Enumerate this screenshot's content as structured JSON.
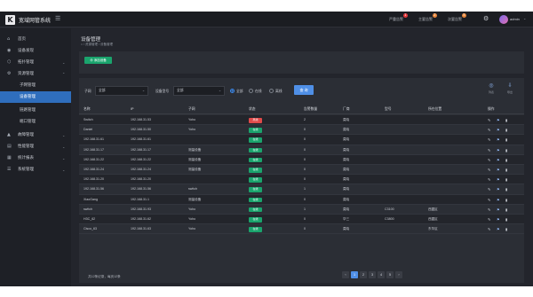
{
  "app": {
    "title": "宽域网管系统",
    "logo_letter": "K"
  },
  "topbar": {
    "alerts": [
      {
        "label": "严重告警",
        "count": "1",
        "color": "#e4393c"
      },
      {
        "label": "主要告警",
        "count": "2",
        "color": "#e8873b"
      },
      {
        "label": "次要告警",
        "count": "5",
        "color": "#e8873b"
      }
    ],
    "username": "admin"
  },
  "sidebar": {
    "items": [
      {
        "label": "首页",
        "icon": "home-icon",
        "glyph": "⌂"
      },
      {
        "label": "设备发现",
        "icon": "discover-icon",
        "glyph": "◉"
      },
      {
        "label": "拓扑管理",
        "icon": "topology-icon",
        "glyph": "⬡",
        "chevron": "⌄"
      },
      {
        "label": "资源管理",
        "icon": "resource-icon",
        "glyph": "⚙",
        "chevron": "⌃"
      },
      {
        "label": "子网管理",
        "sub": true
      },
      {
        "label": "设备管理",
        "sub": true,
        "active": true
      },
      {
        "label": "链路管理",
        "sub": true
      },
      {
        "label": "端口管理",
        "sub": true
      },
      {
        "label": "故障管理",
        "icon": "warning-icon",
        "glyph": "▲",
        "chevron": "⌄"
      },
      {
        "label": "性能管理",
        "icon": "performance-icon",
        "glyph": "▤",
        "chevron": "⌄"
      },
      {
        "label": "统计报表",
        "icon": "report-icon",
        "glyph": "▦",
        "chevron": "⌄"
      },
      {
        "label": "系统管理",
        "icon": "system-icon",
        "glyph": "☰",
        "chevron": "⌄"
      }
    ]
  },
  "page": {
    "title": "设备管理",
    "breadcrumb": "⌂ / 资源管理 / 设备管理",
    "add_button": "⊕ 添加设备"
  },
  "filters": {
    "subnet_label": "子网",
    "subnet_value": "全部",
    "model_label": "设备型号",
    "model_value": "全部",
    "radios": [
      {
        "label": "全部",
        "checked": true
      },
      {
        "label": "在线",
        "checked": false
      },
      {
        "label": "离线",
        "checked": false
      }
    ],
    "query_button": "查 询",
    "tools": [
      {
        "label": "列表",
        "icon": "list-icon",
        "glyph": "◎"
      },
      {
        "label": "导出",
        "icon": "export-icon",
        "glyph": "⇩"
      }
    ]
  },
  "table": {
    "columns": [
      "名称",
      "IP",
      "子网",
      "状态",
      "告警数量",
      "厂商",
      "型号",
      "所在位置",
      "操作"
    ],
    "rows": [
      [
        "Switch",
        "192.168.31.53",
        "Yoho",
        "离线",
        "2",
        "莫晓",
        "",
        ""
      ],
      [
        "Daniel",
        "192.168.31.50",
        "Yoho",
        "在线",
        "0",
        "莫晓",
        "",
        ""
      ],
      [
        "192.168.31.61",
        "192.168.31.61",
        "",
        "在线",
        "0",
        "莫晓",
        "",
        ""
      ],
      [
        "192.168.31.17",
        "192.168.31.17",
        "测量设备",
        "在线",
        "0",
        "莫晓",
        "",
        ""
      ],
      [
        "192.168.31.22",
        "192.168.31.22",
        "测量设备",
        "在线",
        "0",
        "莫晓",
        "",
        ""
      ],
      [
        "192.168.31.24",
        "192.168.31.24",
        "测量设备",
        "在线",
        "0",
        "莫晓",
        "",
        ""
      ],
      [
        "192.168.31.20",
        "192.168.31.20",
        "",
        "在线",
        "0",
        "莫晓",
        "",
        ""
      ],
      [
        "192.168.31.56",
        "192.168.31.56",
        "switch",
        "在线",
        "1",
        "莫晓",
        "",
        ""
      ],
      [
        "XiaoGang",
        "192.168.31.1",
        "测量设备",
        "在线",
        "0",
        "莫晓",
        "",
        ""
      ],
      [
        "switch",
        "192.168.31.93",
        "Yoho",
        "在线",
        "1",
        "莫晓",
        "C3100",
        "西翼区"
      ],
      [
        "H3C_62",
        "192.168.31.62",
        "Yoho",
        "在线",
        "0",
        "华三",
        "C3800",
        "西翼区"
      ],
      [
        "Cisco_63",
        "192.168.31.63",
        "Yoho",
        "在线",
        "0",
        "莫晓",
        "",
        "东华区"
      ]
    ],
    "status_colors": {
      "在线": "#1aa46d",
      "离线": "#e04a4a"
    },
    "row_actions": [
      "edit-icon",
      "view-icon",
      "delete-icon"
    ]
  },
  "pagination": {
    "summary": "共12条记录，每页12条",
    "pages": [
      "‹",
      "1",
      "2",
      "3",
      "4",
      "5",
      "›"
    ],
    "current": "1"
  }
}
